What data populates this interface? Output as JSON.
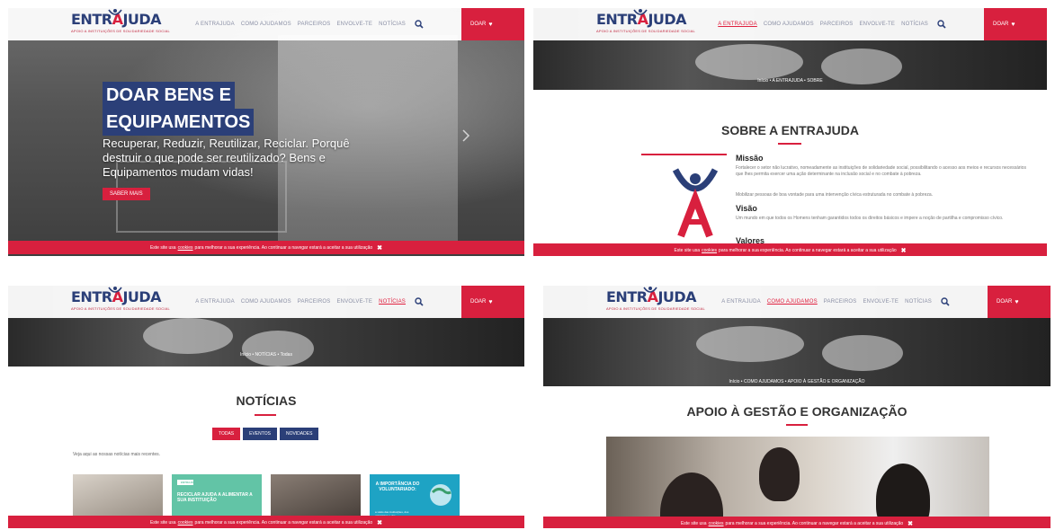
{
  "brand": {
    "logo_text_1": "ENTR",
    "logo_text_2": "A",
    "logo_text_3": "JUDA",
    "tagline": "APOIO A INSTITUIÇÕES DE SOLIDARIEDADE SOCIAL",
    "primary_color": "#d8203e",
    "navy_color": "#2b3f78"
  },
  "nav": {
    "items": [
      "A ENTRAJUDA",
      "COMO AJUDAMOS",
      "PARCEIROS",
      "ENVOLVE-TE",
      "NOTÍCIAS"
    ],
    "search_icon": "search-icon",
    "donate_label": "DOAR",
    "donate_icon": "heart-icon"
  },
  "cookie": {
    "prefix": "Este site usa",
    "link": "cookies",
    "suffix": "para melhorar a sua experiência. Ao continuar a navegar estará a aceitar a sua utilização",
    "close_icon": "close-icon"
  },
  "panel1": {
    "title_line1": "DOAR BENS E",
    "title_line2": "EQUIPAMENTOS",
    "text": "Recuperar, Reduzir, Reutilizar, Reciclar. Porquê destruir o que pode ser reutilizado? Bens e Equipamentos mudam vidas!",
    "button": "SABER MAIS",
    "arrow_icon": "chevron-right-icon"
  },
  "panel2": {
    "breadcrumb": [
      "Início",
      "A ENTRAJUDA",
      "SOBRE"
    ],
    "title": "SOBRE A ENTRAJUDA",
    "missao_title": "Missão",
    "missao_text": "Fortalecer o setor não lucrativo, nomeadamente as instituições de solidariedade social, possibilitando o acesso aos meios e recursos necessários que lhes permita exercer uma ação determinante na inclusão social e no combate à pobreza.",
    "missao_text2": "Mobilizar pessoas de boa vontade para uma intervenção cívica estruturada no combate à pobreza.",
    "visao_title": "Visão",
    "visao_text": "Um mundo em que todos os Homens tenham garantidos todos os direitos básicos e impere a noção de partilha e compromisso cívico.",
    "valores_title": "Valores"
  },
  "panel3": {
    "breadcrumb": [
      "Início",
      "NOTÍCIAS",
      "Todas"
    ],
    "title": "NOTÍCIAS",
    "tabs": [
      "TODAS",
      "EVENTOS",
      "NOVIDADES"
    ],
    "intro": "Veja aqui as nossas notícias mais recentes.",
    "card2_logo": "ENTRAJUDA",
    "card2_title": "RECICLAR AJUDA A ALIMENTAR A SUA INSTITUIÇÃO",
    "card4_title": "A IMPORTÂNCIA DO VOLUNTARIADO:",
    "card4_sub": "a visão das instituições, dos voluntários e dos"
  },
  "panel4": {
    "breadcrumb": [
      "Início",
      "COMO AJUDAMOS",
      "APOIO À GESTÃO E ORGANIZAÇÃO"
    ],
    "title": "APOIO À GESTÃO E ORGANIZAÇÃO"
  }
}
